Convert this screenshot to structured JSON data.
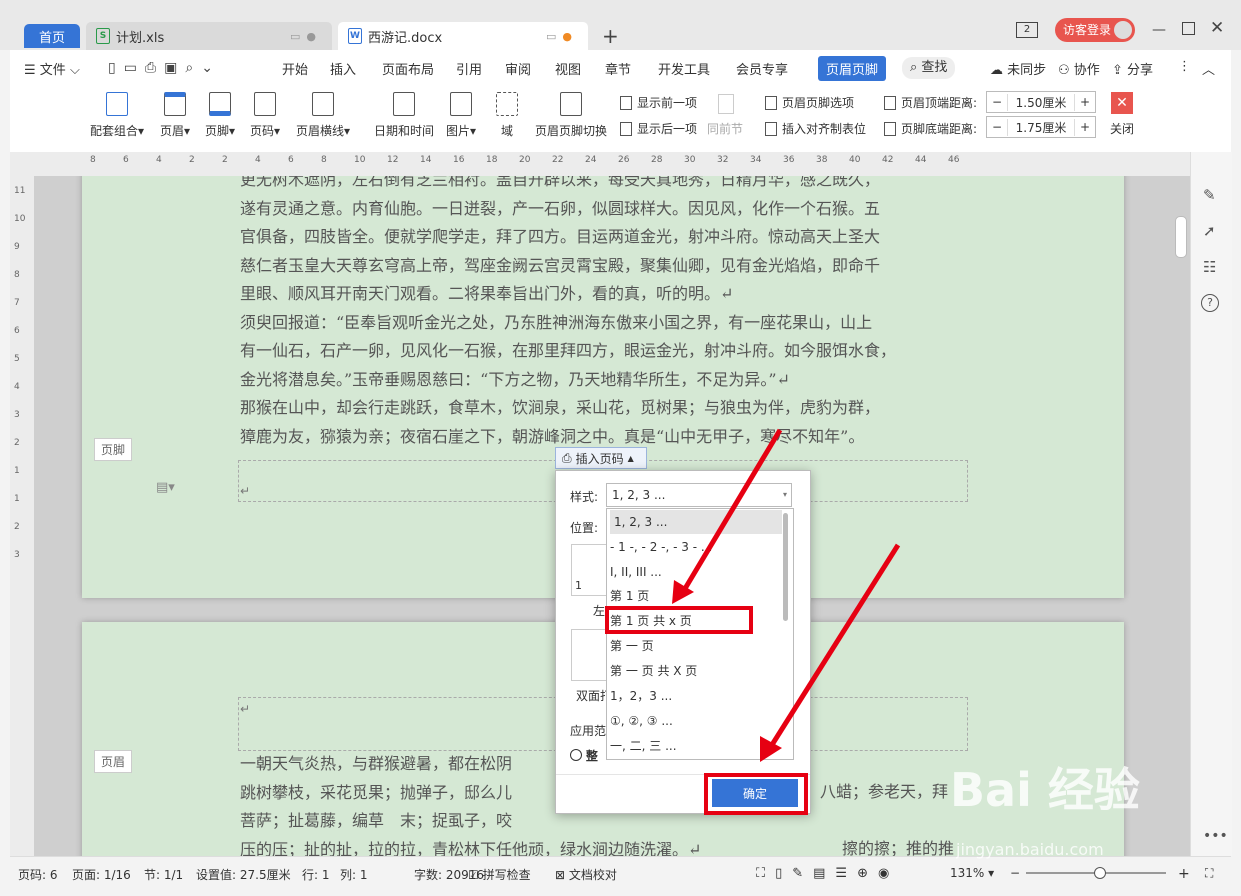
{
  "tabs": {
    "home": "首页",
    "xls": "计划.xls",
    "docx": "西游记.docx",
    "add": "+"
  },
  "window": {
    "guest_login": "访客登录",
    "badge": "2"
  },
  "menu": [
    "文件",
    "开始",
    "插入",
    "页面布局",
    "引用",
    "审阅",
    "视图",
    "章节",
    "开发工具",
    "会员专享",
    "页眉页脚",
    "查找",
    "未同步",
    "协作",
    "分享"
  ],
  "ribbon": {
    "buttons": [
      "配套组合",
      "页眉",
      "页脚",
      "页码",
      "页眉横线",
      "日期和时间",
      "图片",
      "域",
      "页眉页脚切换"
    ],
    "show_prev": "显示前一项",
    "show_next": "显示后一项",
    "same_prev": "同前节",
    "options": "页眉页脚选项",
    "insert_tab": "插入对齐制表位",
    "header_top_label": "页眉顶端距离:",
    "header_top_value": "1.50厘米",
    "footer_bottom_label": "页脚底端距离:",
    "footer_bottom_value": "1.75厘米",
    "close": "关闭"
  },
  "document": {
    "page1_lines": [
      "更无树木遮阴，左右倒有芝兰相衬。盖自开辟以来，每受天真地秀，日精月华，感之既久，",
      "遂有灵通之意。内育仙胞。一日迸裂，产一石卵，似圆球样大。因见风，化作一个石猴。五",
      "官俱备，四肢皆全。便就学爬学走，拜了四方。目运两道金光，射冲斗府。惊动高天上圣大",
      "慈仁者玉皇大天尊玄穹高上帝，驾座金阙云宫灵霄宝殿，聚集仙卿，见有金光焰焰，即命千",
      "里眼、顺风耳开南天门观看。二将果奉旨出门外，看的真，听的明。↵",
      "须臾回报道：“臣奉旨观听金光之处，乃东胜神洲海东傲来小国之界，有一座花果山，山上",
      "有一仙石，石产一卵，见风化一石猴，在那里拜四方，眼运金光，射冲斗府。如今服饵水食，",
      "金光将潜息矣。”玉帝垂赐恩慈曰：“下方之物，乃天地精华所生，不足为异。”↵",
      "那猴在山中，却会行走跳跃，食草木，饮涧泉，采山花，觅树果；与狼虫为伴，虎豹为群，",
      "獐鹿为友，猕猿为亲；夜宿石崖之下，朝游峰洞之中。真是“山中无甲子，寒尽不知年”。"
    ],
    "footer_tag": "页脚",
    "header_tag": "页眉",
    "page2_lines": [
      "一朝天气炎热，与群猴避暑，都在松阴",
      "跳树攀枝，采花觅果；抛弹子，邸么儿",
      "菩萨；扯葛藤，编草　末；捉虱子，咬",
      "压的压；扯的扯，拉的拉，青松林下任他顽，绿水涧边随洗濯。↵"
    ],
    "page2_right": [
      "八蜡；参老天，拜",
      "擦的擦；推的推"
    ]
  },
  "dialog": {
    "insert_page_number": "插入页码",
    "style_label": "样式:",
    "style_value": "1, 2, 3 ...",
    "position_label": "位置:",
    "left_frag": "左",
    "double_frag": "双面打",
    "apply_frag": "应用范",
    "whole_frag": "整",
    "preview_num": "1",
    "options": [
      "1, 2, 3 ...",
      "- 1 -, - 2 -, - 3 - ...",
      "I, II, III ...",
      "第 1 页",
      "第 1 页 共 x 页",
      "第 一 页",
      "第 一 页 共 X 页",
      "1，2，3 ...",
      "①, ②, ③ ...",
      "一, 二, 三 ..."
    ],
    "confirm": "确定"
  },
  "status": {
    "page_code": "页码: 6",
    "page": "页面: 1/16",
    "section": "节: 1/1",
    "setting": "设置值: 27.5厘米",
    "row": "行: 1",
    "col": "列: 1",
    "words": "字数: 20916",
    "spell": "拼写检查",
    "proof": "文档校对",
    "zoom": "131%"
  },
  "watermark": {
    "brand": "Bai 经验",
    "url": "jingyan.baidu.com"
  },
  "ruler_labels": [
    "8",
    "6",
    "4",
    "2",
    "2",
    "4",
    "6",
    "8",
    "10",
    "12",
    "14",
    "16",
    "18",
    "20",
    "22",
    "24",
    "26",
    "28",
    "30",
    "32",
    "34",
    "36",
    "38",
    "40",
    "42",
    "44",
    "46"
  ],
  "vruler_labels": [
    "11",
    "10",
    "9",
    "8",
    "7",
    "6",
    "5",
    "4",
    "3",
    "2",
    "1",
    "1",
    "2",
    "3"
  ],
  "colors": {
    "accent": "#3574d6",
    "page": "#d5e8d4",
    "highlight": "#e60012"
  }
}
